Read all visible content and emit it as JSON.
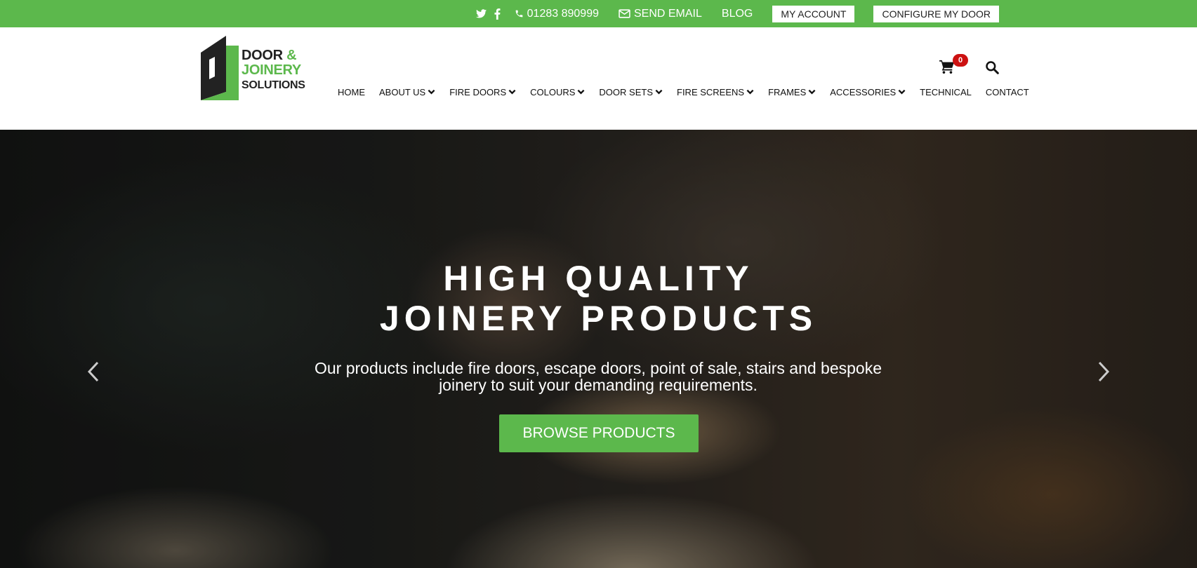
{
  "colors": {
    "brand_green": "#5cb84c",
    "badge_red": "#cc1111",
    "text_dark": "#222222"
  },
  "topbar": {
    "social_icons": [
      "twitter-icon",
      "facebook-icon"
    ],
    "phone": "01283 890999",
    "email_label": "SEND EMAIL",
    "blog_label": "BLOG",
    "account_label": "MY ACCOUNT",
    "configure_label": "CONFIGURE MY DOOR"
  },
  "header": {
    "logo": {
      "line1": "DOOR",
      "ampersand": "&",
      "line2": "JOINERY",
      "line3": "SOLUTIONS"
    },
    "cart_count": "0",
    "nav": [
      {
        "label": "HOME",
        "has_dropdown": false
      },
      {
        "label": "ABOUT US",
        "has_dropdown": true
      },
      {
        "label": "FIRE DOORS",
        "has_dropdown": true
      },
      {
        "label": "COLOURS",
        "has_dropdown": true
      },
      {
        "label": "DOOR SETS",
        "has_dropdown": true
      },
      {
        "label": "FIRE SCREENS",
        "has_dropdown": true
      },
      {
        "label": "FRAMES",
        "has_dropdown": true
      },
      {
        "label": "ACCESSORIES",
        "has_dropdown": true
      },
      {
        "label": "TECHNICAL",
        "has_dropdown": false
      },
      {
        "label": "CONTACT",
        "has_dropdown": false
      }
    ]
  },
  "hero": {
    "title_line1": "HIGH QUALITY",
    "title_line2": "JOINERY PRODUCTS",
    "subtitle_line1": "Our products include fire doors, escape doors, point of sale, stairs and bespoke",
    "subtitle_line2": "joinery to suit your demanding requirements.",
    "button_label": "BROWSE PRODUCTS",
    "prev_icon": "chevron-left-icon",
    "next_icon": "chevron-right-icon"
  }
}
